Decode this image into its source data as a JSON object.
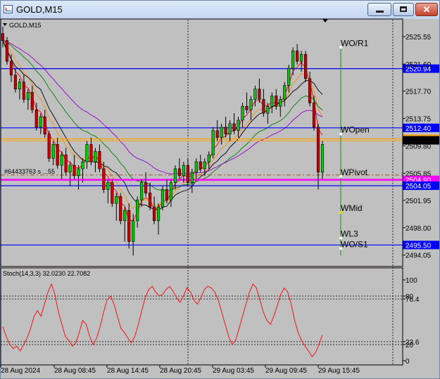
{
  "window": {
    "title": "GOLD,M15"
  },
  "chart_data": {
    "type": "candlestick",
    "symbol_label": "GOLD,M15",
    "bid_label": "#64433763 s  ...55",
    "ylim": [
      2492.5,
      2528.0
    ],
    "price_ticks": [
      "2525.55",
      "2521.60",
      "2517.70",
      "2513.75",
      "2509.80",
      "2505.85",
      "2501.95",
      "2498.00",
      "2494.05"
    ],
    "time_labels": [
      "28 Aug 2024",
      "28 Aug 08:45",
      "28 Aug 14:45",
      "28 Aug 20:45",
      "29 Aug 03:45",
      "29 Aug 09:45",
      "29 Aug 15:45"
    ],
    "hlines": [
      {
        "price": 2520.94,
        "label": "2520.94",
        "color": "#0000ff"
      },
      {
        "price": 2512.4,
        "label": "2512.40",
        "color": "#0000ff"
      },
      {
        "price": 2510.81,
        "label": "2510.81",
        "color": "#ffa500"
      },
      {
        "price": 2504.9,
        "label": "2504.90",
        "color": "#ff00ff"
      },
      {
        "price": 2504.05,
        "label": "2504.05",
        "color": "#0000ff"
      },
      {
        "price": 2495.5,
        "label": "2495.50",
        "color": "#0000ff"
      }
    ],
    "current_price": {
      "price": 2510.6,
      "color": "#000000"
    },
    "pivot_levels": [
      {
        "name": "WO/R1",
        "price": 2524.0
      },
      {
        "name": "WOpen",
        "price": 2511.5
      },
      {
        "name": "WPivot",
        "price": 2505.4
      },
      {
        "name": "WMid",
        "price": 2500.2
      },
      {
        "name": "WL3",
        "price": 2496.5
      },
      {
        "name": "WO/S1",
        "price": 2495.0
      }
    ],
    "ohlc": [
      [
        2526.0,
        2527.0,
        2524.0,
        2525.0
      ],
      [
        2525.0,
        2525.5,
        2521.5,
        2522.0
      ],
      [
        2522.0,
        2523.0,
        2519.0,
        2520.0
      ],
      [
        2520.0,
        2521.0,
        2517.5,
        2518.0
      ],
      [
        2518.0,
        2519.5,
        2516.5,
        2519.0
      ],
      [
        2519.0,
        2520.0,
        2516.0,
        2516.5
      ],
      [
        2516.5,
        2518.0,
        2515.0,
        2517.5
      ],
      [
        2517.5,
        2518.5,
        2514.5,
        2515.0
      ],
      [
        2515.0,
        2516.0,
        2512.0,
        2512.5
      ],
      [
        2512.5,
        2514.5,
        2511.5,
        2514.0
      ],
      [
        2514.0,
        2515.0,
        2511.0,
        2511.5
      ],
      [
        2511.5,
        2512.0,
        2507.5,
        2508.0
      ],
      [
        2508.0,
        2510.5,
        2507.0,
        2510.0
      ],
      [
        2510.0,
        2511.0,
        2506.5,
        2507.0
      ],
      [
        2507.0,
        2509.0,
        2505.0,
        2508.5
      ],
      [
        2508.5,
        2509.5,
        2505.5,
        2506.0
      ],
      [
        2506.0,
        2507.5,
        2504.0,
        2507.0
      ],
      [
        2507.0,
        2508.5,
        2505.0,
        2505.5
      ],
      [
        2505.5,
        2507.0,
        2503.5,
        2506.5
      ],
      [
        2506.5,
        2508.0,
        2504.5,
        2507.5
      ],
      [
        2507.5,
        2510.5,
        2506.5,
        2510.0
      ],
      [
        2510.0,
        2511.0,
        2507.0,
        2507.5
      ],
      [
        2507.5,
        2509.5,
        2506.0,
        2509.0
      ],
      [
        2509.0,
        2510.0,
        2506.0,
        2506.5
      ],
      [
        2506.5,
        2507.5,
        2503.0,
        2503.5
      ],
      [
        2503.5,
        2505.0,
        2501.5,
        2504.5
      ],
      [
        2504.5,
        2505.0,
        2501.0,
        2501.5
      ],
      [
        2501.5,
        2503.0,
        2499.0,
        2502.5
      ],
      [
        2502.5,
        2503.0,
        2498.5,
        2499.0
      ],
      [
        2499.0,
        2501.0,
        2496.0,
        2500.5
      ],
      [
        2500.5,
        2501.5,
        2495.0,
        2496.0
      ],
      [
        2496.0,
        2500.0,
        2494.0,
        2499.0
      ],
      [
        2499.0,
        2502.5,
        2498.0,
        2502.0
      ],
      [
        2502.0,
        2505.0,
        2501.0,
        2504.5
      ],
      [
        2504.5,
        2506.0,
        2502.5,
        2503.0
      ],
      [
        2503.0,
        2504.5,
        2500.5,
        2501.0
      ],
      [
        2501.0,
        2502.5,
        2498.5,
        2499.0
      ],
      [
        2499.0,
        2501.5,
        2497.0,
        2501.0
      ],
      [
        2501.0,
        2504.0,
        2500.5,
        2503.5
      ],
      [
        2503.5,
        2505.0,
        2501.5,
        2502.0
      ],
      [
        2502.0,
        2505.0,
        2501.0,
        2504.5
      ],
      [
        2504.5,
        2507.0,
        2503.5,
        2506.5
      ],
      [
        2506.5,
        2508.0,
        2505.0,
        2505.5
      ],
      [
        2505.5,
        2507.5,
        2504.5,
        2507.0
      ],
      [
        2507.0,
        2508.0,
        2504.0,
        2504.5
      ],
      [
        2504.5,
        2506.5,
        2503.0,
        2506.0
      ],
      [
        2506.0,
        2508.0,
        2505.0,
        2507.5
      ],
      [
        2507.5,
        2508.5,
        2506.0,
        2506.5
      ],
      [
        2506.5,
        2508.0,
        2505.5,
        2507.5
      ],
      [
        2507.5,
        2509.0,
        2506.5,
        2508.5
      ],
      [
        2508.5,
        2512.5,
        2508.0,
        2512.0
      ],
      [
        2512.0,
        2513.5,
        2510.5,
        2511.0
      ],
      [
        2511.0,
        2513.0,
        2510.0,
        2512.5
      ],
      [
        2512.5,
        2514.0,
        2511.0,
        2511.5
      ],
      [
        2511.5,
        2513.5,
        2510.5,
        2513.0
      ],
      [
        2513.0,
        2514.5,
        2511.5,
        2512.0
      ],
      [
        2512.0,
        2514.0,
        2511.0,
        2513.5
      ],
      [
        2513.5,
        2516.0,
        2512.5,
        2515.5
      ],
      [
        2515.5,
        2517.5,
        2514.5,
        2515.0
      ],
      [
        2515.0,
        2517.0,
        2513.5,
        2516.5
      ],
      [
        2516.5,
        2518.5,
        2515.5,
        2518.0
      ],
      [
        2518.0,
        2519.5,
        2516.0,
        2516.5
      ],
      [
        2516.5,
        2518.0,
        2514.0,
        2514.5
      ],
      [
        2514.5,
        2516.0,
        2513.0,
        2515.5
      ],
      [
        2515.5,
        2517.5,
        2514.5,
        2517.0
      ],
      [
        2517.0,
        2518.0,
        2515.0,
        2515.5
      ],
      [
        2515.5,
        2517.0,
        2514.0,
        2516.5
      ],
      [
        2516.5,
        2519.0,
        2515.5,
        2518.5
      ],
      [
        2518.5,
        2521.5,
        2517.5,
        2521.0
      ],
      [
        2521.0,
        2524.0,
        2520.0,
        2523.5
      ],
      [
        2523.5,
        2524.5,
        2521.5,
        2522.0
      ],
      [
        2522.0,
        2523.5,
        2520.5,
        2523.0
      ],
      [
        2523.0,
        2523.5,
        2519.0,
        2519.5
      ],
      [
        2519.5,
        2520.5,
        2515.5,
        2516.0
      ],
      [
        2516.0,
        2517.0,
        2512.0,
        2512.5
      ],
      [
        2512.5,
        2513.0,
        2503.5,
        2506.0
      ],
      [
        2506.0,
        2510.5,
        2505.0,
        2510.0
      ]
    ],
    "stoch": {
      "label": "Stoch(14,3,3) 32.0230 22.7082",
      "ylim": [
        0,
        100
      ],
      "levels": [
        {
          "label": "80",
          "value": 80
        },
        {
          "label": "76.4",
          "value": 76.4
        },
        {
          "label": "23.6",
          "value": 23.6
        },
        {
          "label": "20",
          "value": 20
        }
      ],
      "ticks": [
        {
          "label": "100",
          "value": 100
        },
        {
          "label": "0",
          "value": 0
        }
      ],
      "values": [
        42,
        30,
        20,
        15,
        18,
        12,
        20,
        28,
        40,
        55,
        62,
        55,
        70,
        85,
        95,
        82,
        60,
        45,
        30,
        25,
        18,
        22,
        35,
        50,
        45,
        30,
        20,
        28,
        42,
        60,
        75,
        80,
        70,
        55,
        40,
        35,
        28,
        22,
        30,
        45,
        62,
        78,
        88,
        92,
        85,
        80,
        82,
        88,
        92,
        86,
        78,
        72,
        80,
        90,
        85,
        75,
        70,
        78,
        88,
        92,
        90,
        85,
        75,
        60,
        45,
        30,
        20,
        25,
        40,
        55,
        70,
        85,
        95,
        90,
        75,
        60,
        50,
        45,
        55,
        68,
        82,
        90,
        85,
        70,
        50,
        35,
        25,
        18,
        12,
        5,
        10,
        20,
        32
      ]
    }
  }
}
